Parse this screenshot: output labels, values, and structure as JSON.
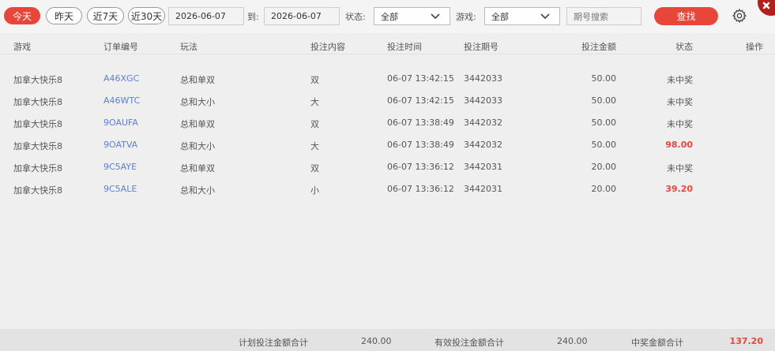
{
  "toolbar": {
    "quick_ranges": [
      "今天",
      "昨天",
      "近7天",
      "近30天"
    ],
    "start_date": "2026-06-07",
    "to_label": "到:",
    "end_date": "2026-06-07",
    "status_label": "状态:",
    "status_value": "全部",
    "game_label": "游戏:",
    "game_value": "全部",
    "period_placeholder": "期号搜索",
    "search_label": "查找"
  },
  "table": {
    "columns": [
      "游戏",
      "订单编号",
      "玩法",
      "投注内容",
      "投注时间",
      "投注期号",
      "投注金额",
      "状态",
      "操作"
    ],
    "rows": [
      {
        "game": "加拿大快乐8",
        "order_id": "A46XGC",
        "play": "总和单双",
        "content": "双",
        "time": "06-07 13:42:15",
        "period": "3442033",
        "amount": "50.00",
        "status": "未中奖",
        "won": false
      },
      {
        "game": "加拿大快乐8",
        "order_id": "A46WTC",
        "play": "总和大小",
        "content": "大",
        "time": "06-07 13:42:15",
        "period": "3442033",
        "amount": "50.00",
        "status": "未中奖",
        "won": false
      },
      {
        "game": "加拿大快乐8",
        "order_id": "9OAUFA",
        "play": "总和单双",
        "content": "双",
        "time": "06-07 13:38:49",
        "period": "3442032",
        "amount": "50.00",
        "status": "未中奖",
        "won": false
      },
      {
        "game": "加拿大快乐8",
        "order_id": "9OATVA",
        "play": "总和大小",
        "content": "大",
        "time": "06-07 13:38:49",
        "period": "3442032",
        "amount": "50.00",
        "status": "98.00",
        "won": true
      },
      {
        "game": "加拿大快乐8",
        "order_id": "9C5AYE",
        "play": "总和单双",
        "content": "双",
        "time": "06-07 13:36:12",
        "period": "3442031",
        "amount": "20.00",
        "status": "未中奖",
        "won": false
      },
      {
        "game": "加拿大快乐8",
        "order_id": "9C5ALE",
        "play": "总和大小",
        "content": "小",
        "time": "06-07 13:36:12",
        "period": "3442031",
        "amount": "20.00",
        "status": "39.20",
        "won": true
      }
    ]
  },
  "footer": {
    "planned_label": "计划投注金额合计",
    "planned_value": "240.00",
    "valid_label": "有效投注金额合计",
    "valid_value": "240.00",
    "win_label": "中奖金额合计",
    "win_value": "137.20"
  },
  "colors": {
    "accent": "#e8463b",
    "link": "#5a7fd6",
    "close": "#b1201c"
  },
  "icons": [
    "chevron-down-icon",
    "gear-icon",
    "close-icon"
  ]
}
